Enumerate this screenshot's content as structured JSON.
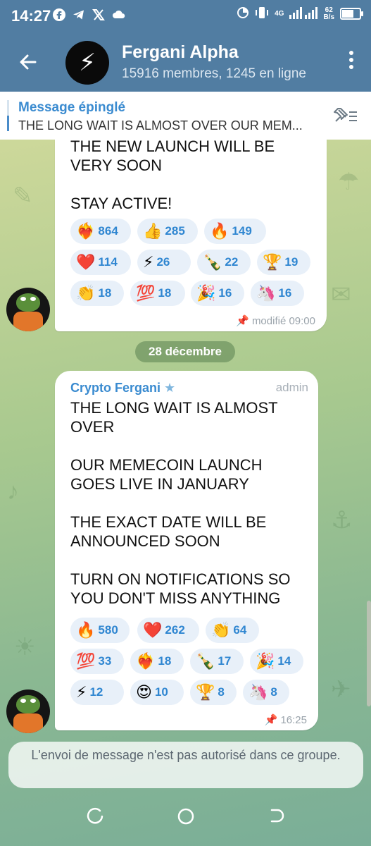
{
  "status": {
    "time": "14:27",
    "network": "4G",
    "speed_value": "62",
    "speed_unit": "B/s",
    "left_icons": [
      "facebook-icon",
      "telegram-icon",
      "x-icon",
      "cloud-icon"
    ],
    "right_icons": [
      "data-saver-icon",
      "vibrate-icon",
      "signal-icon",
      "battery-icon"
    ]
  },
  "header": {
    "title": "Fergani Alpha",
    "subtitle": "15916 membres, 1245 en ligne",
    "avatar_emoji": "⚡"
  },
  "pinned": {
    "title": "Message épinglé",
    "text": "THE LONG WAIT IS ALMOST OVER  OUR MEM..."
  },
  "messages": [
    {
      "text": "THE NEW LAUNCH WILL BE\nVERY SOON\n\nSTAY ACTIVE!",
      "reactions": [
        {
          "emoji": "❤️‍🔥",
          "count": "864"
        },
        {
          "emoji": "👍",
          "count": "285"
        },
        {
          "emoji": "🔥",
          "count": "149"
        },
        {
          "emoji": "❤️",
          "count": "114"
        },
        {
          "emoji": "⚡",
          "count": "26"
        },
        {
          "emoji": "🍾",
          "count": "22"
        },
        {
          "emoji": "🏆",
          "count": "19"
        },
        {
          "emoji": "👏",
          "count": "18"
        },
        {
          "emoji": "💯",
          "count": "18"
        },
        {
          "emoji": "🎉",
          "count": "16"
        },
        {
          "emoji": "🦄",
          "count": "16"
        }
      ],
      "meta": "modifié 09:00"
    },
    {
      "sender": "Crypto Fergani",
      "role": "admin",
      "text": "THE LONG WAIT IS ALMOST\nOVER\n\nOUR MEMECOIN LAUNCH\nGOES LIVE IN JANUARY\n\nTHE EXACT DATE WILL BE\nANNOUNCED SOON\n\nTURN ON NOTIFICATIONS  SO\nYOU DON'T MISS ANYTHING",
      "reactions": [
        {
          "emoji": "🔥",
          "count": "580"
        },
        {
          "emoji": "❤️",
          "count": "262"
        },
        {
          "emoji": "👏",
          "count": "64"
        },
        {
          "emoji": "💯",
          "count": "33"
        },
        {
          "emoji": "❤️‍🔥",
          "count": "18"
        },
        {
          "emoji": "🍾",
          "count": "17"
        },
        {
          "emoji": "🎉",
          "count": "14"
        },
        {
          "emoji": "⚡",
          "count": "12"
        },
        {
          "emoji": "😍",
          "count": "10"
        },
        {
          "emoji": "🏆",
          "count": "8"
        },
        {
          "emoji": "🦄",
          "count": "8"
        }
      ],
      "meta": "16:25"
    }
  ],
  "date_separator": "28 décembre",
  "notice": "L'envoi de message n'est pas autorisé dans ce groupe.",
  "colors": {
    "header": "#517da2",
    "accent": "#3a8bd0",
    "reaction_bg": "#e8f0f9"
  }
}
